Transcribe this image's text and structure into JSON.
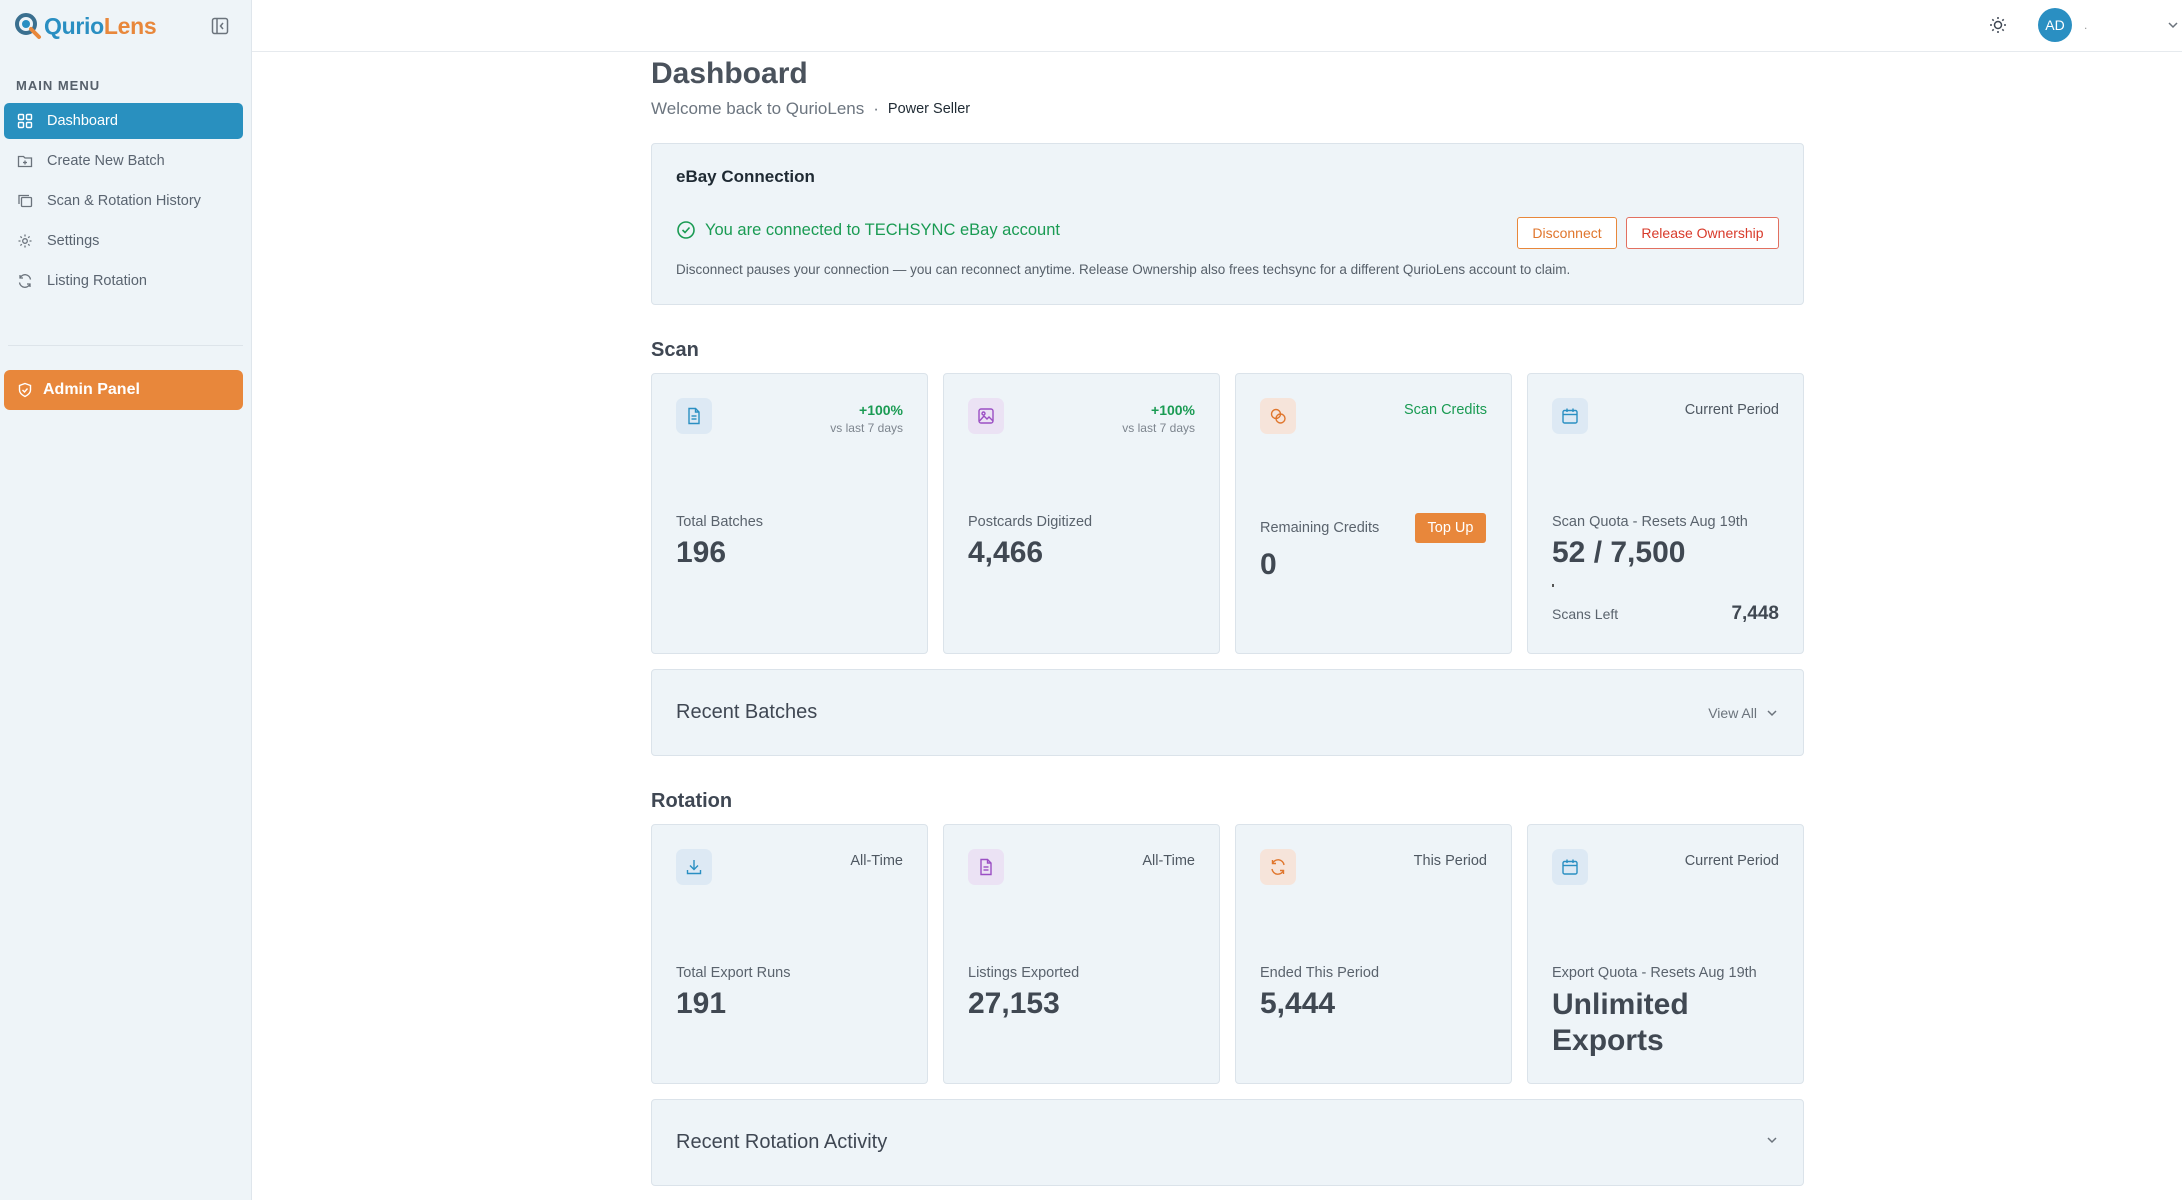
{
  "brand": {
    "name_part1": "Qurio",
    "name_part2": "Lens"
  },
  "sidebar": {
    "menu_heading": "MAIN MENU",
    "items": [
      {
        "label": "Dashboard",
        "icon": "grid-icon",
        "active": true
      },
      {
        "label": "Create New Batch",
        "icon": "folder-plus-icon"
      },
      {
        "label": "Scan & Rotation History",
        "icon": "copy-icon"
      },
      {
        "label": "Settings",
        "icon": "gear-icon"
      },
      {
        "label": "Listing Rotation",
        "icon": "refresh-icon"
      }
    ],
    "admin_label": "Admin Panel"
  },
  "topbar": {
    "avatar_initials": "AD",
    "user_name": "."
  },
  "page": {
    "title": "Dashboard",
    "welcome": "Welcome back to QurioLens",
    "separator": "·",
    "tier": "Power Seller"
  },
  "ebay": {
    "title": "eBay Connection",
    "status": "You are connected to TECHSYNC eBay account",
    "disconnect_label": "Disconnect",
    "release_label": "Release Ownership",
    "note": "Disconnect pauses your connection — you can reconnect anytime. Release Ownership also frees techsync for a different QurioLens account to claim."
  },
  "scan": {
    "section_title": "Scan",
    "cards": [
      {
        "trend": "+100%",
        "trend_sub": "vs last 7 days",
        "label": "Total Batches",
        "value": "196"
      },
      {
        "trend": "+100%",
        "trend_sub": "vs last 7 days",
        "label": "Postcards Digitized",
        "value": "4,466"
      },
      {
        "tag": "Scan Credits",
        "label": "Remaining Credits",
        "value": "0",
        "button": "Top Up"
      },
      {
        "tag": "Current Period",
        "label": "Scan Quota - Resets Aug 19th",
        "value": "52 / 7,500",
        "quota_used_fraction": 0.0069,
        "scans_left_label": "Scans Left",
        "scans_left_value": "7,448"
      }
    ],
    "recent_title": "Recent Batches",
    "view_all": "View All"
  },
  "rotation": {
    "section_title": "Rotation",
    "cards": [
      {
        "tag": "All-Time",
        "label": "Total Export Runs",
        "value": "191"
      },
      {
        "tag": "All-Time",
        "label": "Listings Exported",
        "value": "27,153"
      },
      {
        "tag": "This Period",
        "label": "Ended This Period",
        "value": "5,444"
      },
      {
        "tag": "Current Period",
        "label": "Export Quota - Resets Aug 19th",
        "value": "Unlimited Exports"
      }
    ],
    "recent_title": "Recent Rotation Activity"
  },
  "colors": {
    "primary": "#2990bf",
    "accent": "#e8873b",
    "success": "#1a9b53",
    "danger": "#d83a2a"
  }
}
